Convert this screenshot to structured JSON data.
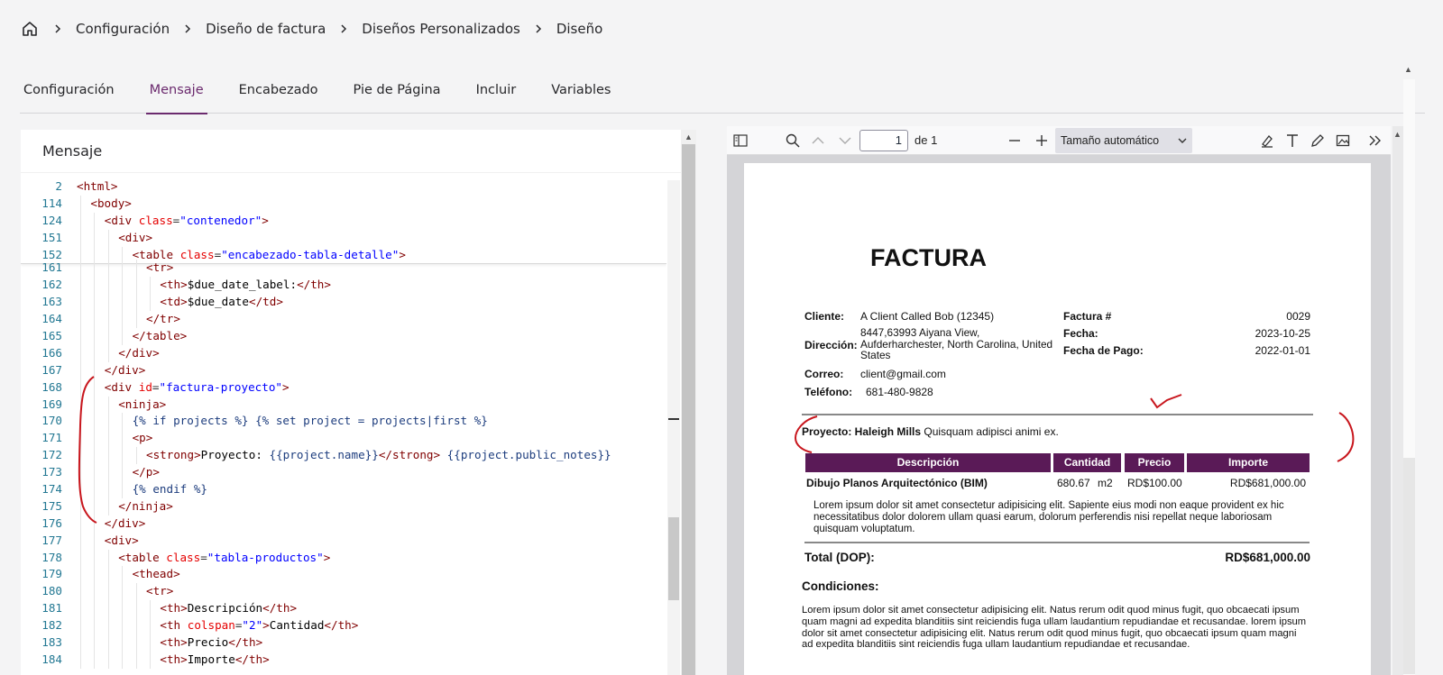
{
  "breadcrumb": {
    "items": [
      "Configuración",
      "Diseño de factura",
      "Diseños Personalizados",
      "Diseño"
    ]
  },
  "tabs": [
    {
      "label": "Configuración",
      "active": false
    },
    {
      "label": "Mensaje",
      "active": true
    },
    {
      "label": "Encabezado",
      "active": false
    },
    {
      "label": "Pie de Página",
      "active": false
    },
    {
      "label": "Incluir",
      "active": false
    },
    {
      "label": "Variables",
      "active": false
    }
  ],
  "editor": {
    "title": "Mensaje",
    "sticky_lines": [
      {
        "n": "2",
        "indent": 0,
        "html": "<span class='t-tag'>&lt;html&gt;</span>"
      },
      {
        "n": "114",
        "indent": 1,
        "html": "<span class='t-tag'>&lt;body&gt;</span>"
      },
      {
        "n": "124",
        "indent": 2,
        "html": "<span class='t-tag'>&lt;div</span> <span class='t-attr'>class</span>=<span class='t-str'>\"contenedor\"</span><span class='t-tag'>&gt;</span>"
      },
      {
        "n": "151",
        "indent": 3,
        "html": "<span class='t-tag'>&lt;div&gt;</span>"
      },
      {
        "n": "152",
        "indent": 4,
        "html": "<span class='t-tag'>&lt;table</span> <span class='t-attr'>class</span>=<span class='t-str'>\"encabezado-tabla-detalle\"</span><span class='t-tag'>&gt;</span>"
      }
    ],
    "lines": [
      {
        "n": "161",
        "indent": 5,
        "html": "<span class='t-tag'>&lt;tr&gt;</span>"
      },
      {
        "n": "162",
        "indent": 6,
        "html": "<span class='t-tag'>&lt;th&gt;</span><span class='t-txt'>$due_date_label:</span><span class='t-tag'>&lt;/th&gt;</span>"
      },
      {
        "n": "163",
        "indent": 6,
        "html": "<span class='t-tag'>&lt;td&gt;</span><span class='t-txt'>$due_date</span><span class='t-tag'>&lt;/td&gt;</span>"
      },
      {
        "n": "164",
        "indent": 5,
        "html": "<span class='t-tag'>&lt;/tr&gt;</span>"
      },
      {
        "n": "165",
        "indent": 4,
        "html": "<span class='t-tag'>&lt;/table&gt;</span>"
      },
      {
        "n": "166",
        "indent": 3,
        "html": "<span class='t-tag'>&lt;/div&gt;</span>"
      },
      {
        "n": "167",
        "indent": 2,
        "html": "<span class='t-tag'>&lt;/div&gt;</span>"
      },
      {
        "n": "168",
        "indent": 2,
        "html": "<span class='t-tag'>&lt;div</span> <span class='t-attr'>id</span>=<span class='t-str'>\"factura-proyecto\"</span><span class='t-tag'>&gt;</span>"
      },
      {
        "n": "169",
        "indent": 3,
        "html": "<span class='t-tag'>&lt;ninja&gt;</span>"
      },
      {
        "n": "170",
        "indent": 4,
        "html": "<span class='t-tpl'>{% if projects %} {% set project = projects|first %}</span>"
      },
      {
        "n": "171",
        "indent": 4,
        "html": "<span class='t-tag'>&lt;p&gt;</span>"
      },
      {
        "n": "172",
        "indent": 5,
        "html": "<span class='t-tag'>&lt;strong&gt;</span><span class='t-txt'>Proyecto: </span><span class='t-tpl'>{{project.name}}</span><span class='t-tag'>&lt;/strong&gt;</span> <span class='t-tpl'>{{project.public_notes}}</span>"
      },
      {
        "n": "173",
        "indent": 4,
        "html": "<span class='t-tag'>&lt;/p&gt;</span>"
      },
      {
        "n": "174",
        "indent": 4,
        "html": "<span class='t-tpl'>{% endif %}</span>"
      },
      {
        "n": "175",
        "indent": 3,
        "html": "<span class='t-tag'>&lt;/ninja&gt;</span>"
      },
      {
        "n": "176",
        "indent": 2,
        "html": "<span class='t-tag'>&lt;/div&gt;</span>"
      },
      {
        "n": "177",
        "indent": 2,
        "html": "<span class='t-tag'>&lt;div&gt;</span>"
      },
      {
        "n": "178",
        "indent": 3,
        "html": "<span class='t-tag'>&lt;table</span> <span class='t-attr'>class</span>=<span class='t-str'>\"tabla-productos\"</span><span class='t-tag'>&gt;</span>"
      },
      {
        "n": "179",
        "indent": 4,
        "html": "<span class='t-tag'>&lt;thead&gt;</span>"
      },
      {
        "n": "180",
        "indent": 5,
        "html": "<span class='t-tag'>&lt;tr&gt;</span>"
      },
      {
        "n": "181",
        "indent": 6,
        "html": "<span class='t-tag'>&lt;th&gt;</span><span class='t-txt'>Descripción</span><span class='t-tag'>&lt;/th&gt;</span>"
      },
      {
        "n": "182",
        "indent": 6,
        "html": "<span class='t-tag'>&lt;th</span> <span class='t-attr'>colspan</span>=<span class='t-str'>\"2\"</span><span class='t-tag'>&gt;</span><span class='t-txt'>Cantidad</span><span class='t-tag'>&lt;/th&gt;</span>"
      },
      {
        "n": "183",
        "indent": 6,
        "html": "<span class='t-tag'>&lt;th&gt;</span><span class='t-txt'>Precio</span><span class='t-tag'>&lt;/th&gt;</span>"
      },
      {
        "n": "184",
        "indent": 6,
        "html": "<span class='t-tag'>&lt;th&gt;</span><span class='t-txt'>Importe</span><span class='t-tag'>&lt;/th&gt;</span>"
      }
    ]
  },
  "pdf_toolbar": {
    "page_number": "1",
    "page_of": "de 1",
    "zoom": "Tamaño automático"
  },
  "invoice": {
    "title": "FACTURA",
    "client_label": "Cliente:",
    "client_value": "A Client Called Bob (12345)",
    "address_label": "Dirección:",
    "address_lines": [
      "8447,63993 Aiyana View,",
      "Aufderharchester, North Carolina, United",
      "States"
    ],
    "email_label": "Correo:",
    "email_value": "client@gmail.com",
    "phone_label": "Teléfono:",
    "phone_value": "681-480-9828",
    "invoice_no_label": "Factura #",
    "invoice_no_value": "0029",
    "date_label": "Fecha:",
    "date_value": "2023-10-25",
    "due_label": "Fecha de Pago:",
    "due_value": "2022-01-01",
    "project_label": "Proyecto: Haleigh Mills",
    "project_notes": "Quisquam adipisci animi ex.",
    "table_headers": [
      "Descripción",
      "Cantidad",
      "Precio",
      "Importe"
    ],
    "item": {
      "description": "Dibujo Planos Arquitectónico (BIM)",
      "quantity": "680.67",
      "unit": "m2",
      "price": "RD$100.00",
      "amount": "RD$681,000.00"
    },
    "item_notes": [
      "Lorem ipsum dolor sit amet consectetur adipisicing elit. Sapiente eius modi non eaque provident ex hic",
      "necessitatibus dolor dolorem ullam quasi earum, dolorum perferendis nisi repellat neque laboriosam",
      "quisquam voluptatum."
    ],
    "total_label": "Total (DOP):",
    "total_value": "RD$681,000.00",
    "conditions_title": "Condiciones:",
    "conditions_lines": [
      "Lorem ipsum dolor sit amet consectetur adipisicing elit. Natus rerum odit quod minus fugit, quo obcaecati ipsum",
      "quam magni ad expedita blanditiis sint reiciendis fuga ullam laudantium repudiandae et recusandae. lorem ipsum",
      "dolor sit amet consectetur adipisicing elit. Natus rerum odit quod minus fugit, quo obcaecati ipsum quam magni",
      "ad expedita blanditiis sint reiciendis fuga ullam laudantium repudiandae et recusandae."
    ]
  },
  "colors": {
    "accent": "#6b2a6e",
    "table_header": "#5a1a57",
    "annotation": "#c8161d"
  },
  "icons": [
    "home-icon",
    "chevron-right-icon",
    "sidebar-toggle-icon",
    "search-icon",
    "chevron-up-icon",
    "chevron-down-icon",
    "zoom-out-icon",
    "zoom-in-icon",
    "highlight-icon",
    "text-icon",
    "draw-icon",
    "image-icon",
    "more-tools-icon"
  ]
}
